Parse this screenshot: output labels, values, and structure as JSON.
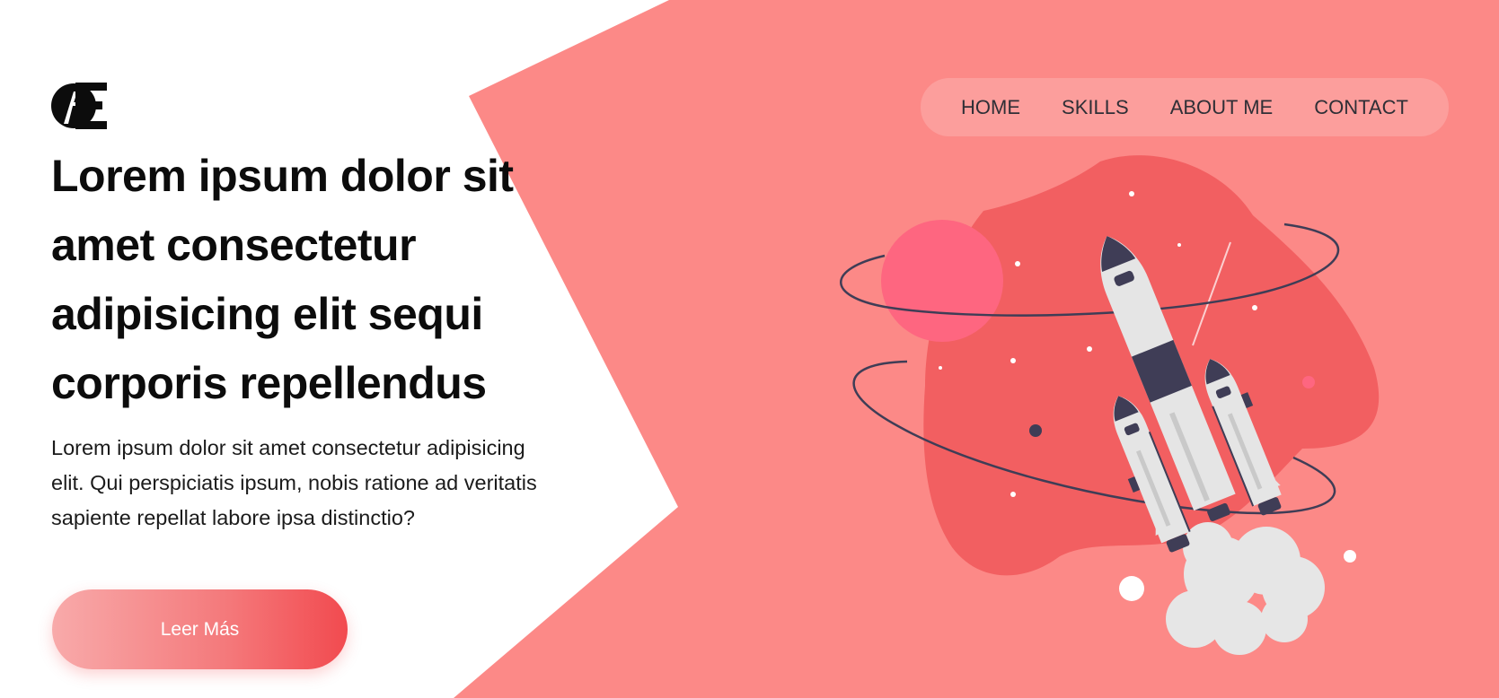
{
  "brand": {
    "logo_icon": "ae-monogram-icon"
  },
  "nav": {
    "items": [
      {
        "label": "HOME"
      },
      {
        "label": "SKILLS"
      },
      {
        "label": "ABOUT ME"
      },
      {
        "label": "CONTACT"
      }
    ]
  },
  "hero": {
    "title_lines": [
      "Lorem ipsum dolor sit",
      "amet consectetur",
      "adipisicing elit sequi",
      "corporis repellendus"
    ],
    "text_lines": [
      "Lorem ipsum dolor sit amet consectetur adipisicing",
      "elit. Qui perspiciatis ipsum, nobis ratione ad veritatis",
      "sapiente repellat labore ipsa distinctio?"
    ],
    "cta_label": "Leer Más"
  },
  "illustration": {
    "icon": "rocket-launch-illustration"
  },
  "colors": {
    "background": "#ffffff",
    "shape": "#fc8987",
    "blob": "#f25f61",
    "planet": "#fe6680",
    "rocket_body": "#e5e5e5",
    "rocket_dark": "#3f3d56",
    "smoke": "#e6e6e6",
    "cta_start": "#f8aaaa",
    "cta_end": "#f24a4f",
    "text": "#0c0c0c"
  }
}
